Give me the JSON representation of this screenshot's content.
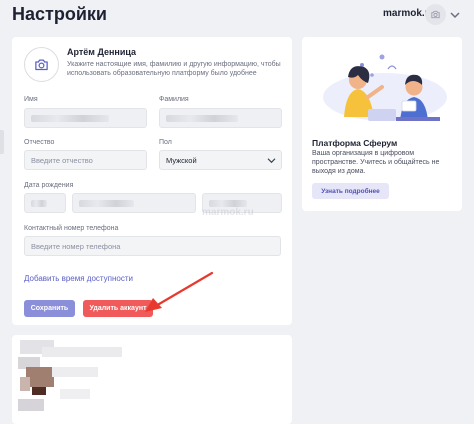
{
  "header": {
    "title": "Настройки",
    "username": "marmok.ru"
  },
  "profile": {
    "name": "Артём Денница",
    "hint": "Укажите настоящие имя, фамилию и другую информацию, чтобы использовать образовательную платформу было удобнее"
  },
  "form": {
    "first_name_label": "Имя",
    "last_name_label": "Фамилия",
    "patronymic_label": "Отчество",
    "patronymic_placeholder": "Введите отчество",
    "gender_label": "Пол",
    "gender_value": "Мужской",
    "birth_date_label": "Дата рождения",
    "phone_label": "Контактный номер телефона",
    "phone_placeholder": "Введите номер телефона",
    "availability_link": "Добавить время доступности",
    "save_button": "Сохранить",
    "delete_button": "Удалить аккаунт"
  },
  "promo": {
    "title": "Платформа Сферум",
    "text": "Ваша организация в цифровом пространстве. Учитесь и общайтесь не выходя из дома.",
    "button": "Узнать подробнее"
  },
  "watermark": "marmok.ru",
  "colors": {
    "accent": "#8b8ed8",
    "danger": "#f05a5a",
    "arrow": "#e8392f",
    "link": "#5b5fc7"
  }
}
